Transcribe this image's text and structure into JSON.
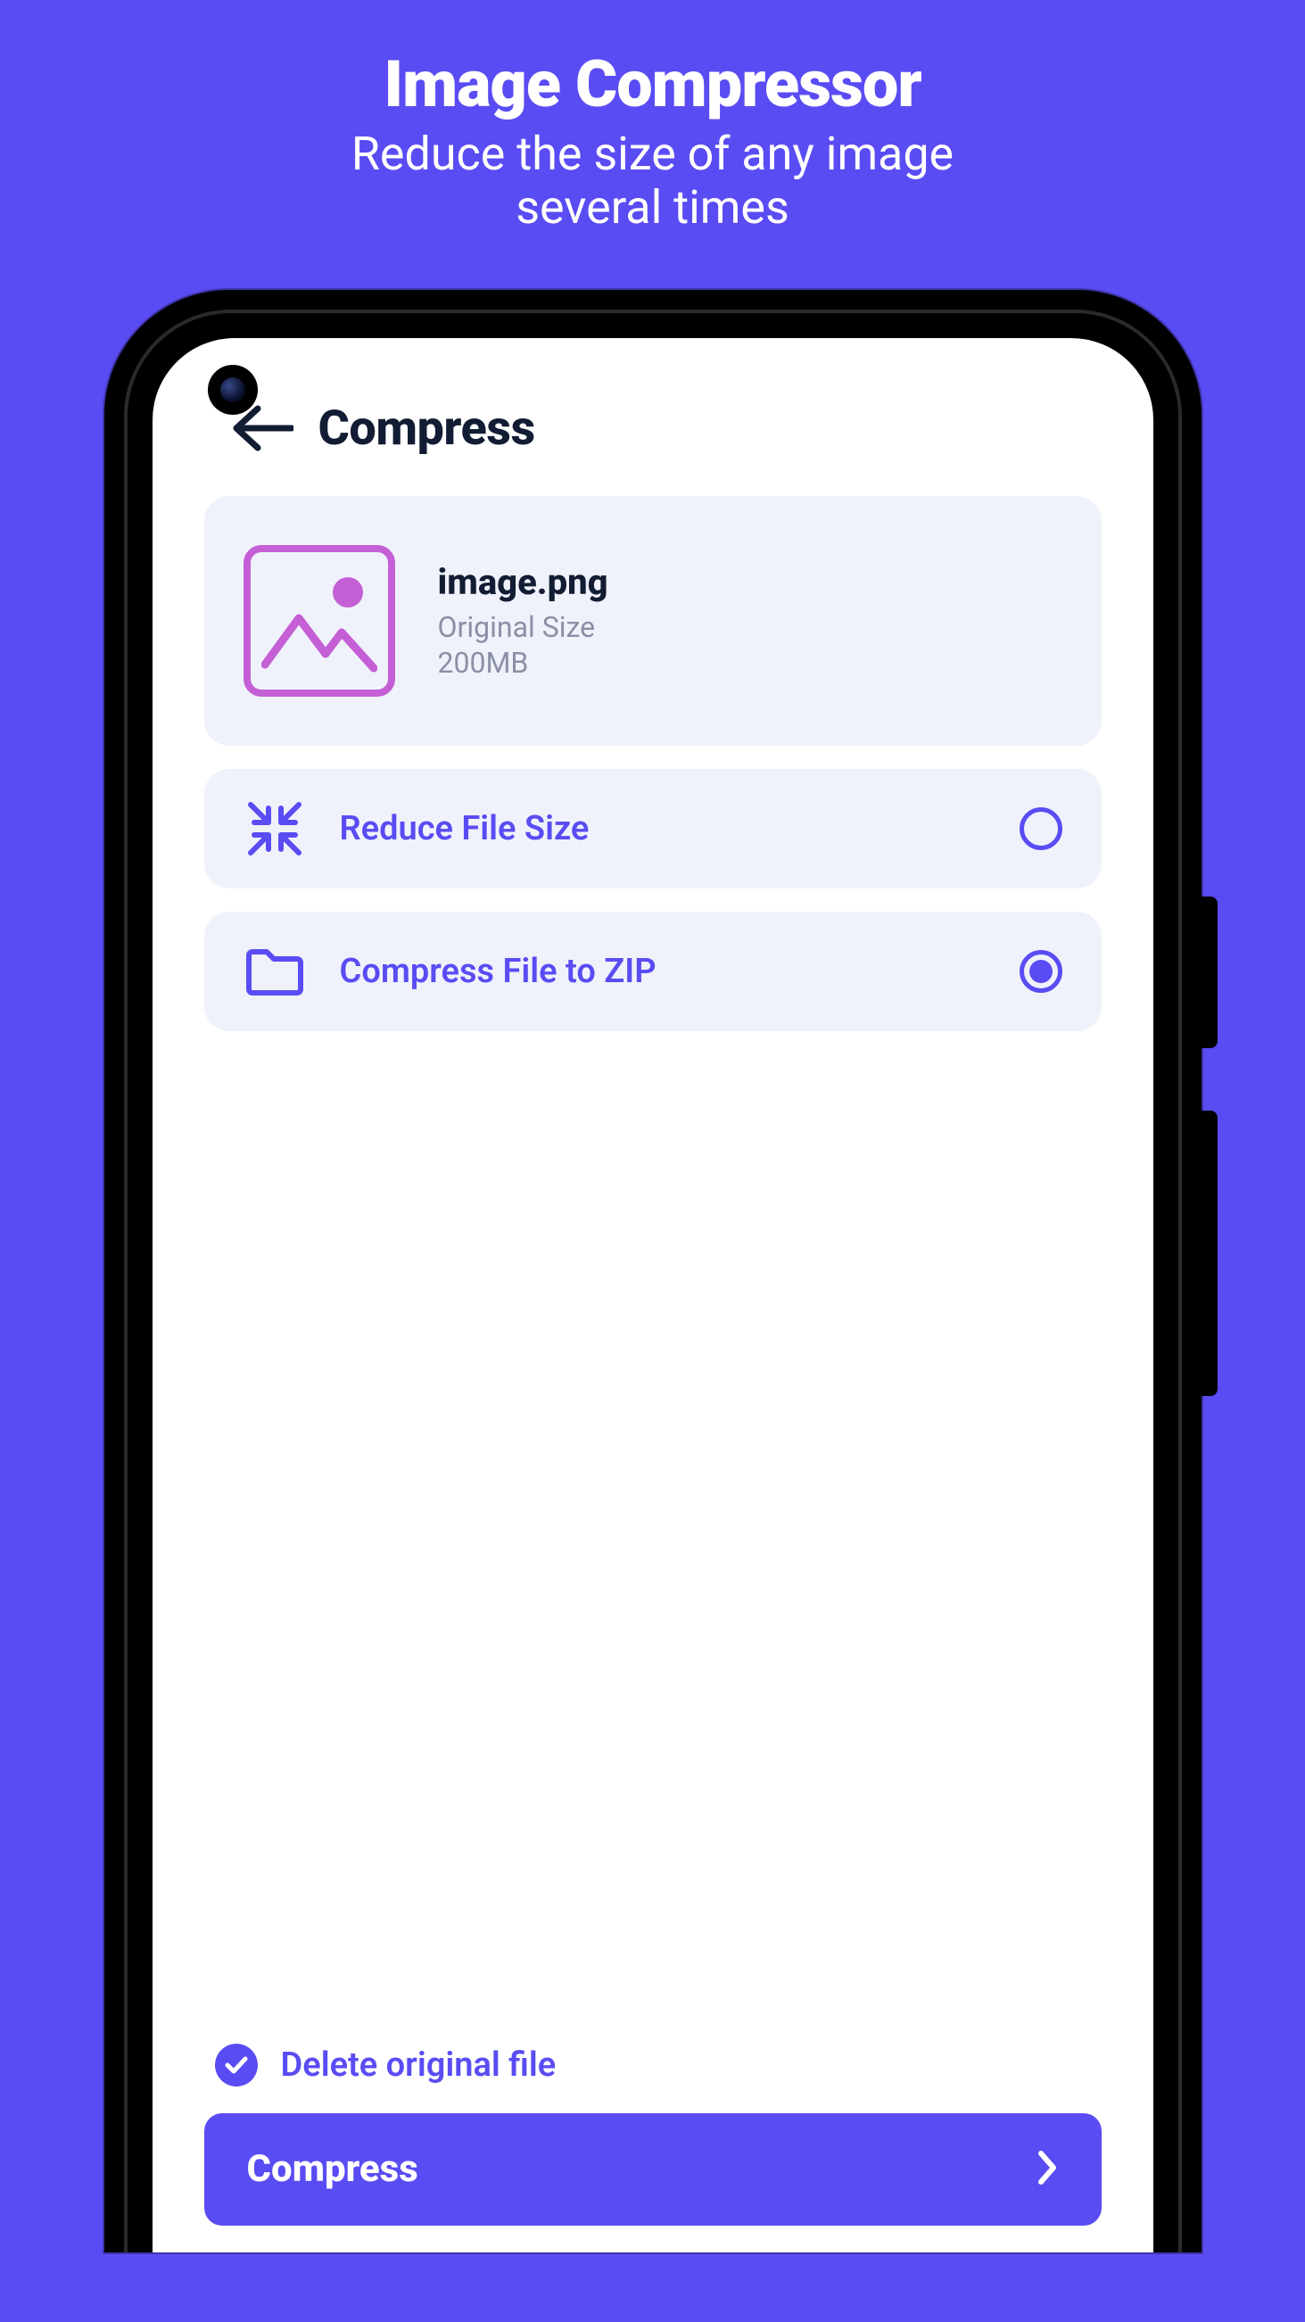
{
  "promo": {
    "title": "Image Compressor",
    "subtitle_line1": "Reduce the size of any image",
    "subtitle_line2": "several times"
  },
  "screen": {
    "title": "Compress",
    "file": {
      "name": "image.png",
      "size_label": "Original Size",
      "size_value": "200MB"
    },
    "options": {
      "reduce": {
        "label": "Reduce File Size",
        "selected": false
      },
      "zip": {
        "label": "Compress File to ZIP",
        "selected": true
      }
    },
    "delete_checkbox": {
      "label": "Delete original file",
      "checked": true
    },
    "action_button": {
      "label": "Compress"
    }
  },
  "icons": {
    "back": "back-arrow-icon",
    "image_thumb": "image-placeholder-icon",
    "shrink": "shrink-arrows-icon",
    "folder": "folder-icon",
    "check": "checkmark-icon",
    "chevron": "chevron-right-icon"
  },
  "colors": {
    "accent": "#5A4CF3",
    "thumb_accent": "#c45fd5",
    "dark": "#121c33",
    "muted": "#8a90a6",
    "panel": "#f0f2fb"
  }
}
